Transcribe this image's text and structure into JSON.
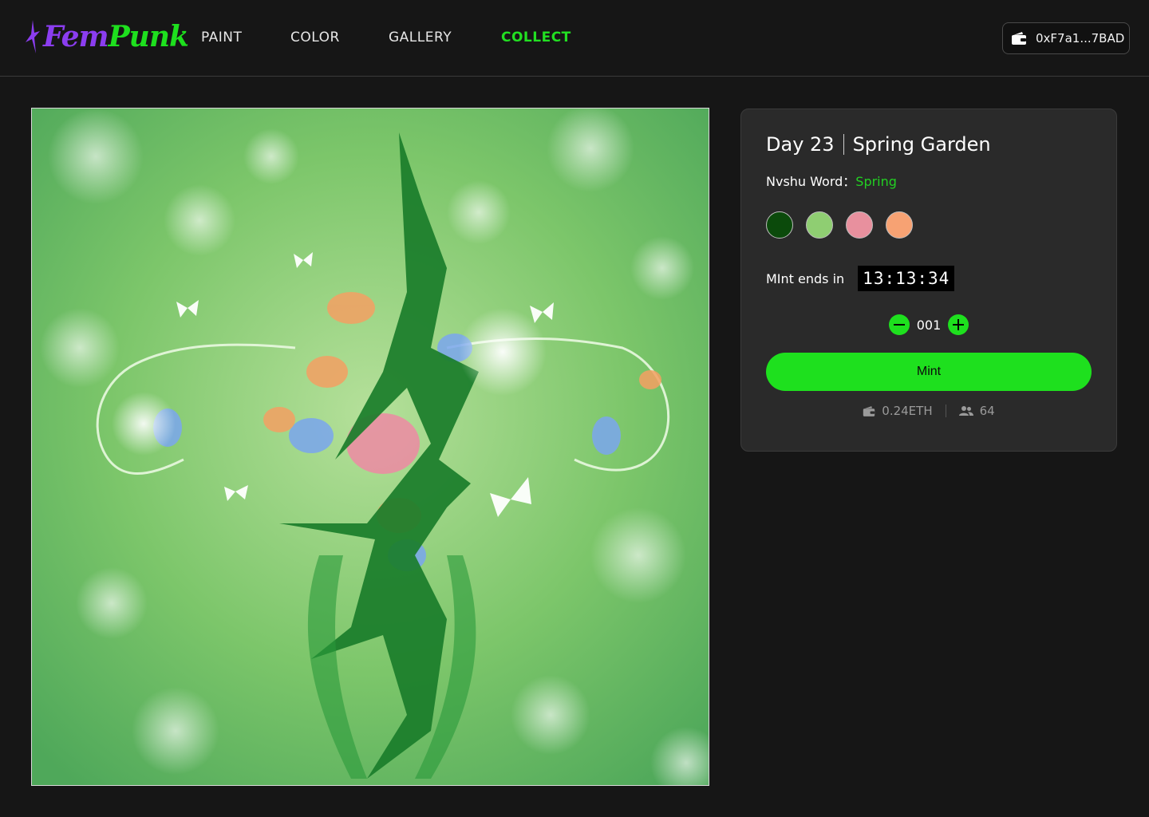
{
  "header": {
    "logo": {
      "part1": "Fem",
      "part2": "Punk"
    },
    "nav": [
      {
        "label": "PAINT",
        "active": false
      },
      {
        "label": "COLOR",
        "active": false
      },
      {
        "label": "GALLERY",
        "active": false
      },
      {
        "label": "COLLECT",
        "active": true
      }
    ],
    "wallet": {
      "address": "0xF7a1...7BAD",
      "icon": "wallet-icon"
    }
  },
  "artwork": {
    "icon": "artwork-image"
  },
  "panel": {
    "day": "Day 23",
    "name": "Spring Garden",
    "nvshu_label": "Nvshu Word：",
    "nvshu_word": "Spring",
    "palette": [
      "#0b4a0b",
      "#8fce72",
      "#e8909e",
      "#f7a273"
    ],
    "mint_ends_label": "MInt ends in",
    "countdown": "13:13:34",
    "quantity": "001",
    "mint_label": "Mint",
    "price": "0.24ETH",
    "holders": "64"
  },
  "colors": {
    "accent": "#1ee01e",
    "brand_purple": "#8b3df0",
    "background": "#161616",
    "panel": "#2a2a2a"
  }
}
